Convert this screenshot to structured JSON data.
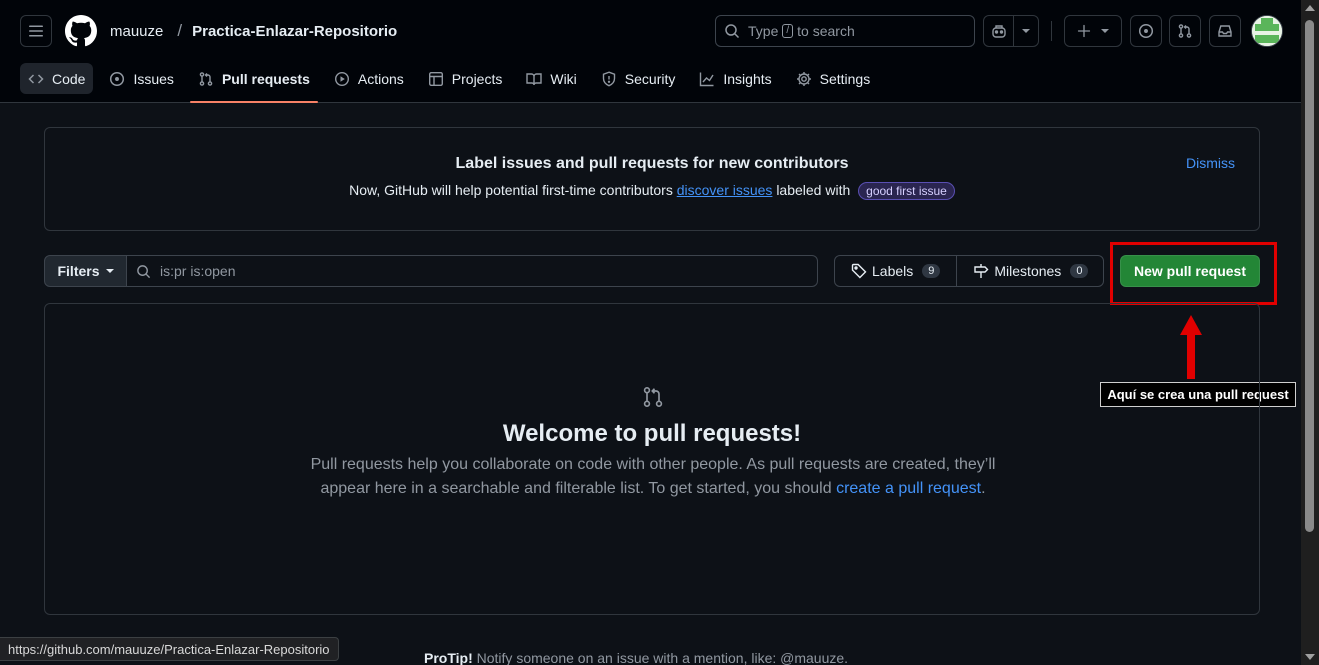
{
  "header": {
    "owner": "mauuze",
    "separator": "/",
    "repo": "Practica-Enlazar-Repositorio",
    "search_prefix": "Type",
    "search_key": "/",
    "search_suffix": "to search"
  },
  "tabs": [
    {
      "label": "Code",
      "icon": "code-icon"
    },
    {
      "label": "Issues",
      "icon": "issue-opened-icon"
    },
    {
      "label": "Pull requests",
      "icon": "git-pull-request-icon",
      "active": true
    },
    {
      "label": "Actions",
      "icon": "play-icon"
    },
    {
      "label": "Projects",
      "icon": "table-icon"
    },
    {
      "label": "Wiki",
      "icon": "book-icon"
    },
    {
      "label": "Security",
      "icon": "shield-icon"
    },
    {
      "label": "Insights",
      "icon": "graph-icon"
    },
    {
      "label": "Settings",
      "icon": "gear-icon"
    }
  ],
  "banner": {
    "title": "Label issues and pull requests for new contributors",
    "text_before": "Now, GitHub will help potential first-time contributors",
    "link": "discover issues",
    "text_after": "labeled with",
    "label": "good first issue",
    "dismiss": "Dismiss"
  },
  "filter_bar": {
    "filters_label": "Filters",
    "query": "is:pr is:open",
    "labels_label": "Labels",
    "labels_count": "9",
    "milestones_label": "Milestones",
    "milestones_count": "0",
    "new_pr_label": "New pull request"
  },
  "annotation": {
    "text": "Aquí se crea una pull request",
    "color": "#e00000"
  },
  "blank_slate": {
    "title": "Welcome to pull requests!",
    "text": "Pull requests help you collaborate on code with other people. As pull requests are created, they’ll appear here in a searchable and filterable list. To get started, you should",
    "link": "create a pull request",
    "end": "."
  },
  "protip": {
    "bold": "ProTip!",
    "text": "Notify someone on an issue with a mention, like: @mauuze."
  },
  "status_url": "https://github.com/mauuze/Practica-Enlazar-Repositorio",
  "colors": {
    "background": "#0d1117",
    "header": "#010409",
    "accent_green": "#238636",
    "link": "#4493f8",
    "tab_underline": "#f78166"
  }
}
